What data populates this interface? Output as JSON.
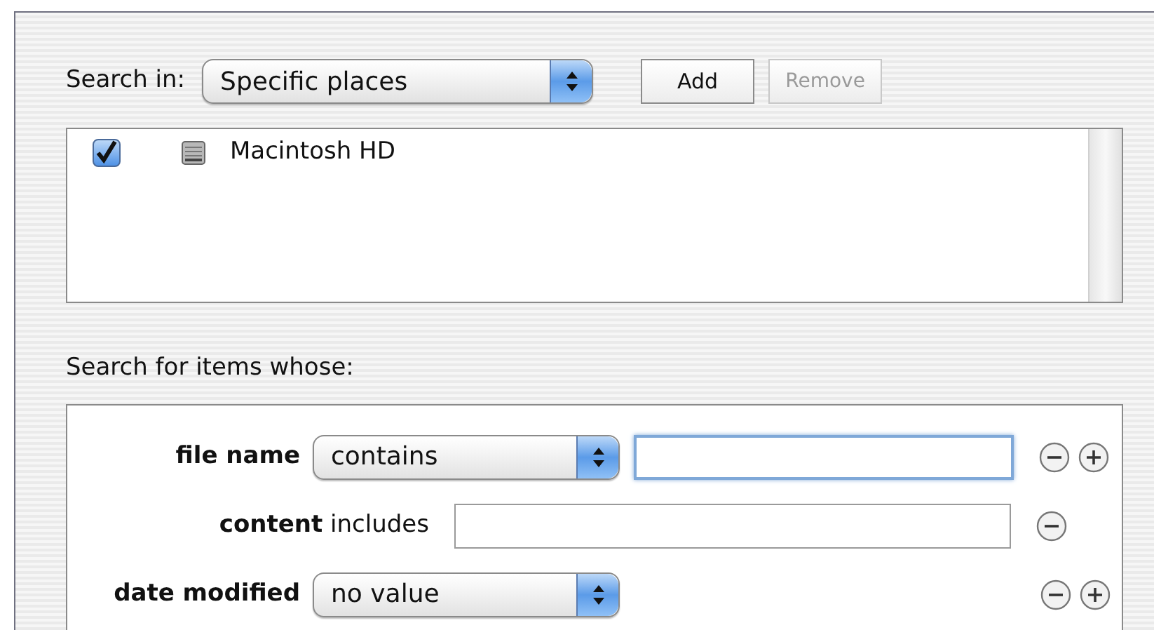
{
  "search_in": {
    "label": "Search in:",
    "value": "Specific places"
  },
  "buttons": [
    {
      "label": "Add",
      "disabled": false
    },
    {
      "label": "Remove",
      "disabled": true
    }
  ],
  "places": [
    {
      "name": "Macintosh HD",
      "checked": true
    }
  ],
  "criteria_title": "Search for items whose:",
  "criteria": [
    {
      "kind": "popup",
      "label": "file name",
      "value": "contains",
      "field": {
        "focused": true
      },
      "plus": true
    },
    {
      "kind": "text",
      "label": "**content** includes",
      "field": {
        "focused": false
      },
      "plus": false
    },
    {
      "kind": "popup",
      "label": "date modified",
      "value": "no value",
      "plus": true
    }
  ]
}
